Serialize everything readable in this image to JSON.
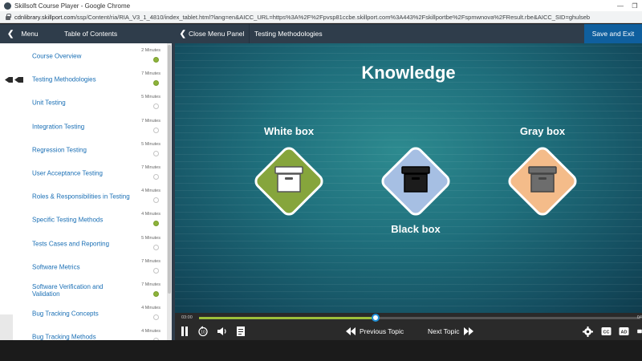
{
  "browser": {
    "window_title": "Skillsoft Course Player - Google Chrome",
    "url_host": "cdnlibrary.skillport.com",
    "url_path": "/ssp/Content/ria/RIA_V3_1_4810/index_tablet.html?lang=en&AICC_URL=https%3A%2F%2Fpvsp81ccbe.skillport.com%3A443%2Fskillportbe%2Fspmwnova%2FResult.rbe&AICC_SID=ghulseb"
  },
  "navbar": {
    "menu_label": "Menu",
    "toc_label": "Table of Contents",
    "close_panel_label": "Close Menu Panel",
    "current_topic": "Testing Methodologies",
    "save_exit_label": "Save and Exit"
  },
  "toc": {
    "items": [
      {
        "label": "Course Overview",
        "duration": "2 Minutes",
        "done": true
      },
      {
        "label": "Testing Methodologies",
        "duration": "7 Minutes",
        "done": true,
        "active": true
      },
      {
        "label": "Unit Testing",
        "duration": "5 Minutes",
        "done": false
      },
      {
        "label": "Integration Testing",
        "duration": "7 Minutes",
        "done": false
      },
      {
        "label": "Regression Testing",
        "duration": "5 Minutes",
        "done": false
      },
      {
        "label": "User Acceptance Testing",
        "duration": "7 Minutes",
        "done": false
      },
      {
        "label": "Roles & Responsibilities in Testing",
        "duration": "4 Minutes",
        "done": false
      },
      {
        "label": "Specific Testing Methods",
        "duration": "4 Minutes",
        "done": true
      },
      {
        "label": "Tests Cases and Reporting",
        "duration": "5 Minutes",
        "done": false
      },
      {
        "label": "Software Metrics",
        "duration": "7 Minutes",
        "done": false
      },
      {
        "label": "Software Verification and Validation",
        "duration": "7 Minutes",
        "done": true
      },
      {
        "label": "Bug Tracking Concepts",
        "duration": "4 Minutes",
        "done": false
      },
      {
        "label": "Bug Tracking Methods",
        "duration": "4 Minutes",
        "done": false
      }
    ]
  },
  "slide": {
    "heading": "Knowledge",
    "boxes": [
      {
        "title": "White box",
        "color": "#86a53c",
        "icon_fill": "#ffffff",
        "icon_stroke": "#555555"
      },
      {
        "title": "Black box",
        "color": "#a6bfe3",
        "icon_fill": "#1c1c1c",
        "icon_stroke": "#000000"
      },
      {
        "title": "Gray box",
        "color": "#f4bc8a",
        "icon_fill": "#6d6d6d",
        "icon_stroke": "#444444"
      }
    ]
  },
  "player": {
    "time_current": "03:00",
    "time_total": "04",
    "progress_fraction": 0.4,
    "prev_label": "Previous Topic",
    "next_label": "Next Topic",
    "accent_color": "#9cbf3b"
  }
}
